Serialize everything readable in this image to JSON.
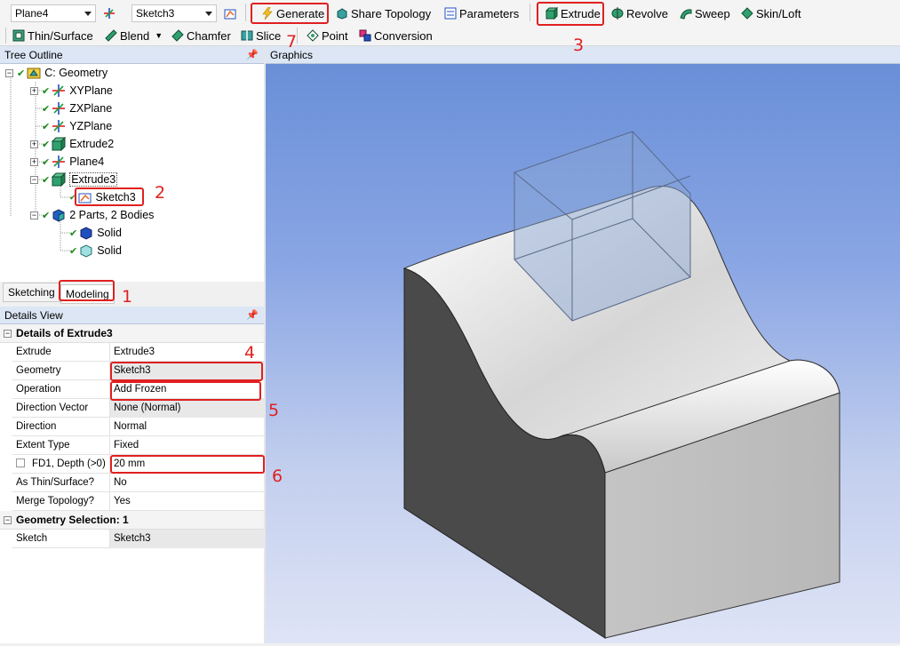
{
  "toolbar1": {
    "plane_combo": "Plane4",
    "sketch_combo": "Sketch3",
    "generate": "Generate",
    "share_topology": "Share Topology",
    "parameters": "Parameters",
    "extrude": "Extrude",
    "revolve": "Revolve",
    "sweep": "Sweep",
    "skin_loft": "Skin/Loft"
  },
  "toolbar2": {
    "thin_surface": "Thin/Surface",
    "blend": "Blend",
    "chamfer": "Chamfer",
    "slice": "Slice",
    "point": "Point",
    "conversion": "Conversion"
  },
  "tree_outline": {
    "title": "Tree Outline",
    "items": [
      {
        "label": "C: Geometry"
      },
      {
        "label": "XYPlane"
      },
      {
        "label": "ZXPlane"
      },
      {
        "label": "YZPlane"
      },
      {
        "label": "Extrude2"
      },
      {
        "label": "Plane4"
      },
      {
        "label": "Extrude3"
      },
      {
        "label": "Sketch3"
      },
      {
        "label": "2 Parts, 2 Bodies"
      },
      {
        "label": "Solid"
      },
      {
        "label": "Solid"
      }
    ]
  },
  "tabs": {
    "sketching": "Sketching",
    "modeling": "Modeling"
  },
  "details": {
    "title": "Details View",
    "section1": "Details of Extrude3",
    "rows": [
      {
        "label": "Extrude",
        "value": "Extrude3"
      },
      {
        "label": "Geometry",
        "value": "Sketch3"
      },
      {
        "label": "Operation",
        "value": "Add Frozen"
      },
      {
        "label": "Direction Vector",
        "value": "None (Normal)"
      },
      {
        "label": "Direction",
        "value": "Normal"
      },
      {
        "label": "Extent Type",
        "value": "Fixed"
      },
      {
        "label": "FD1, Depth (>0)",
        "value": "20 mm"
      },
      {
        "label": "As Thin/Surface?",
        "value": "No"
      },
      {
        "label": "Merge Topology?",
        "value": "Yes"
      }
    ],
    "section2": "Geometry Selection: 1",
    "rows2": [
      {
        "label": "Sketch",
        "value": "Sketch3"
      }
    ]
  },
  "graphics": {
    "title": "Graphics"
  },
  "annotations": {
    "n1": "1",
    "n2": "2",
    "n3": "3",
    "n4": "4",
    "n5": "5",
    "n6": "6",
    "n7": "7"
  },
  "colors": {
    "annotation": "#e02020",
    "header": "#dce6f4"
  }
}
